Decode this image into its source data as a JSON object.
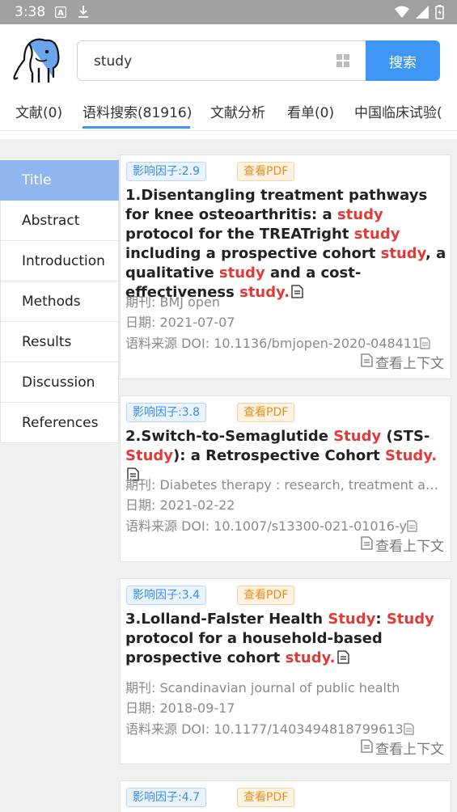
{
  "status": {
    "time": "3:38"
  },
  "search": {
    "value": "study",
    "button_label": "搜索"
  },
  "tabs": [
    {
      "label": "文献(0)"
    },
    {
      "label": "语料搜索(81916)"
    },
    {
      "label": "文献分析"
    },
    {
      "label": "看单(0)"
    },
    {
      "label": "中国临床试验("
    }
  ],
  "sidebar": {
    "items": [
      {
        "label": "Title",
        "active": true
      },
      {
        "label": "Abstract"
      },
      {
        "label": "Introduction"
      },
      {
        "label": "Methods"
      },
      {
        "label": "Results"
      },
      {
        "label": "Discussion"
      },
      {
        "label": "References"
      }
    ]
  },
  "colors": {
    "accent": "#3f97f5",
    "highlight": "#e53935",
    "sidebar_active": "#8fb6ef"
  },
  "results": [
    {
      "impact": "影响因子:2.9",
      "pdf_label": "查看PDF",
      "title_segments": [
        {
          "t": "1.Disentangling treatment pathways for knee osteoarthritis: a ",
          "h": false
        },
        {
          "t": "study",
          "h": true
        },
        {
          "t": " protocol for the TREATright ",
          "h": false
        },
        {
          "t": "study",
          "h": true
        },
        {
          "t": " including a prospective cohort ",
          "h": false
        },
        {
          "t": "study",
          "h": true
        },
        {
          "t": ", a qualitative ",
          "h": false
        },
        {
          "t": "study",
          "h": true
        },
        {
          "t": " and a cost-effectiveness ",
          "h": false
        },
        {
          "t": "study.",
          "h": true
        }
      ],
      "journal": "期刊: BMJ open",
      "date": "日期: 2021-07-07",
      "doi": "语料来源 DOI: 10.1136/bmjopen-2020-048411",
      "context_label": "查看上下文"
    },
    {
      "impact": "影响因子:3.8",
      "pdf_label": "查看PDF",
      "title_segments": [
        {
          "t": "2.Switch-to-Semaglutide ",
          "h": false
        },
        {
          "t": "Study",
          "h": true
        },
        {
          "t": " (STS-",
          "h": false
        },
        {
          "t": "Study",
          "h": true
        },
        {
          "t": "): a Retrospective Cohort ",
          "h": false
        },
        {
          "t": "Study.",
          "h": true
        }
      ],
      "journal": "期刊: Diabetes therapy : research, treatment and education of diabetes and related disorders",
      "date": "日期: 2021-02-22",
      "doi": "语料来源 DOI: 10.1007/s13300-021-01016-y",
      "context_label": "查看上下文"
    },
    {
      "impact": "影响因子:3.4",
      "pdf_label": "查看PDF",
      "title_segments": [
        {
          "t": "3.Lolland-Falster Health ",
          "h": false
        },
        {
          "t": "Study",
          "h": true
        },
        {
          "t": ": ",
          "h": false
        },
        {
          "t": "Study",
          "h": true
        },
        {
          "t": " protocol for a household-based prospective cohort ",
          "h": false
        },
        {
          "t": "study.",
          "h": true
        }
      ],
      "journal": "期刊: Scandinavian journal of public health",
      "date": "日期: 2018-09-17",
      "doi": "语料来源 DOI: 10.1177/1403494818799613",
      "context_label": "查看上下文"
    },
    {
      "impact": "影响因子:4.7",
      "pdf_label": "查看PDF"
    }
  ]
}
